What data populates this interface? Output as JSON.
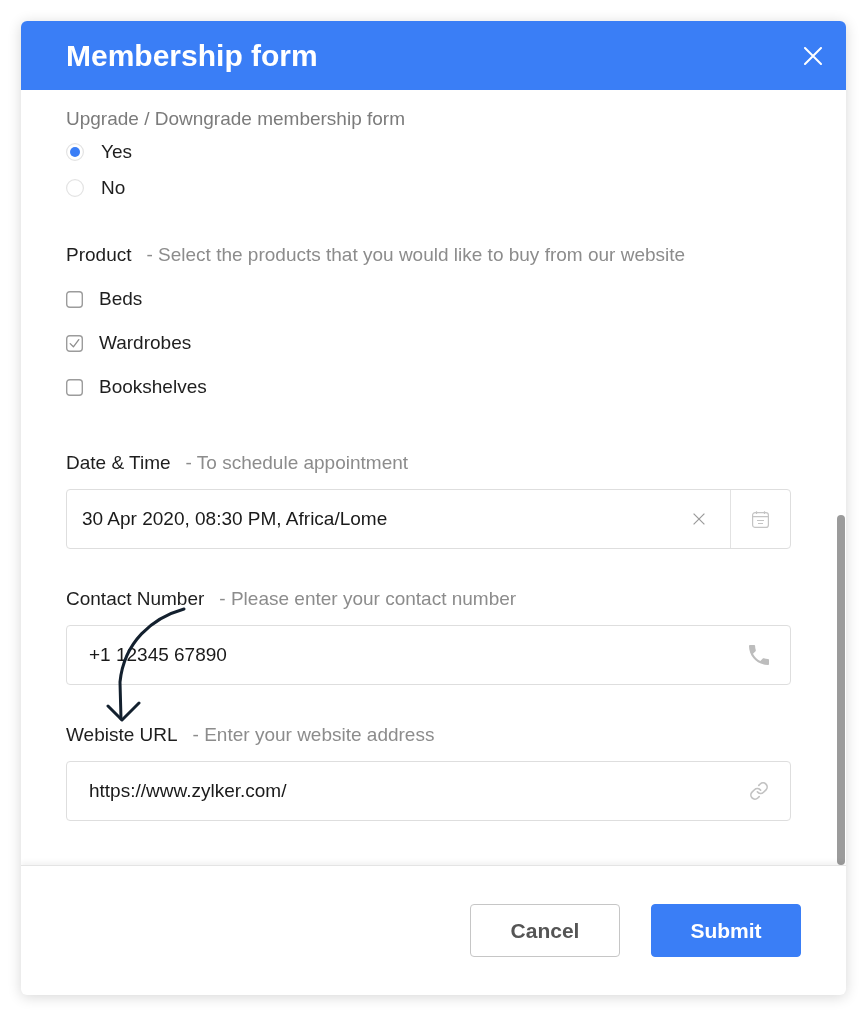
{
  "window": {
    "title": "Membership form"
  },
  "fields": [
    {
      "kind": "radio",
      "label": "Upgrade / Downgrade membership form",
      "options": [
        {
          "label": "Yes",
          "selected": true
        },
        {
          "label": "No",
          "selected": false
        }
      ]
    },
    {
      "kind": "checkbox",
      "label": "Product",
      "hint": "- Select the products that you would like to buy from our website",
      "options": [
        {
          "label": "Beds",
          "checked": false
        },
        {
          "label": "Wardrobes",
          "checked": true
        },
        {
          "label": "Bookshelves",
          "checked": false
        }
      ]
    },
    {
      "kind": "datetime",
      "label": "Date & Time",
      "hint": "- To schedule appointment",
      "value": "30 Apr 2020, 08:30 PM, Africa/Lome"
    },
    {
      "kind": "phone",
      "label": "Contact Number",
      "hint": "- Please enter your contact number",
      "value": "+1 12345 67890"
    },
    {
      "kind": "url",
      "label": "Webiste URL",
      "hint": "- Enter your website address",
      "value": "https://www.zylker.com/"
    }
  ],
  "buttons": [
    {
      "label": "Cancel",
      "kind": "secondary"
    },
    {
      "label": "Submit",
      "kind": "primary"
    }
  ]
}
